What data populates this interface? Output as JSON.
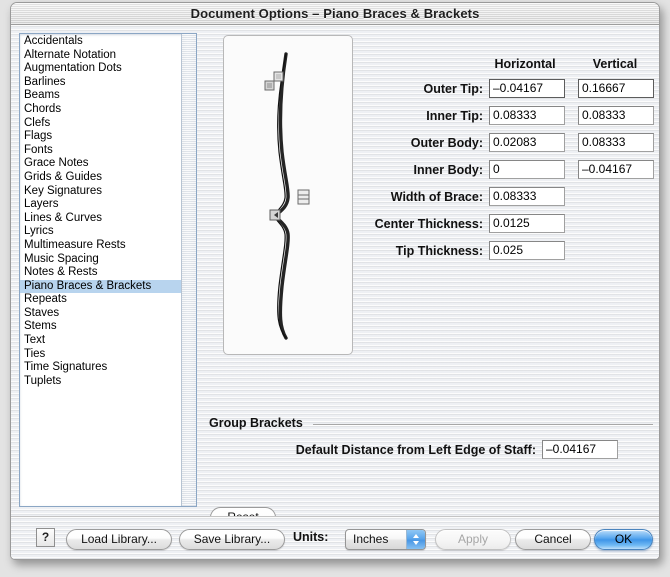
{
  "window": {
    "title": "Document Options – Piano Braces & Brackets"
  },
  "sidebar": {
    "items": [
      {
        "label": "Accidentals",
        "selected": false
      },
      {
        "label": "Alternate Notation",
        "selected": false
      },
      {
        "label": "Augmentation Dots",
        "selected": false
      },
      {
        "label": "Barlines",
        "selected": false
      },
      {
        "label": "Beams",
        "selected": false
      },
      {
        "label": "Chords",
        "selected": false
      },
      {
        "label": "Clefs",
        "selected": false
      },
      {
        "label": "Flags",
        "selected": false
      },
      {
        "label": "Fonts",
        "selected": false
      },
      {
        "label": "Grace Notes",
        "selected": false
      },
      {
        "label": "Grids & Guides",
        "selected": false
      },
      {
        "label": "Key Signatures",
        "selected": false
      },
      {
        "label": "Layers",
        "selected": false
      },
      {
        "label": "Lines & Curves",
        "selected": false
      },
      {
        "label": "Lyrics",
        "selected": false
      },
      {
        "label": "Multimeasure Rests",
        "selected": false
      },
      {
        "label": "Music Spacing",
        "selected": false
      },
      {
        "label": "Notes & Rests",
        "selected": false
      },
      {
        "label": "Piano Braces & Brackets",
        "selected": true
      },
      {
        "label": "Repeats",
        "selected": false
      },
      {
        "label": "Staves",
        "selected": false
      },
      {
        "label": "Stems",
        "selected": false
      },
      {
        "label": "Text",
        "selected": false
      },
      {
        "label": "Ties",
        "selected": false
      },
      {
        "label": "Time Signatures",
        "selected": false
      },
      {
        "label": "Tuplets",
        "selected": false
      }
    ]
  },
  "preview": {
    "name": "piano-brace-preview",
    "handles": [
      "outer-tip-handle",
      "inner-tip-handle",
      "inner-body-handle",
      "thickness-handle"
    ]
  },
  "params": {
    "column_headers": {
      "horizontal": "Horizontal",
      "vertical": "Vertical"
    },
    "rows": [
      {
        "label": "Outer Tip:",
        "horizontal": "–0.04167",
        "vertical": "0.16667",
        "focused": true
      },
      {
        "label": "Inner Tip:",
        "horizontal": "0.08333",
        "vertical": "0.08333",
        "focused": false
      },
      {
        "label": "Outer Body:",
        "horizontal": "0.02083",
        "vertical": "0.08333",
        "focused": false
      },
      {
        "label": "Inner Body:",
        "horizontal": "0",
        "vertical": "–0.04167",
        "focused": false
      },
      {
        "label": "Width of Brace:",
        "horizontal": "0.08333",
        "vertical": null,
        "focused": false
      },
      {
        "label": "Center Thickness:",
        "horizontal": "0.0125",
        "vertical": null,
        "focused": false
      },
      {
        "label": "Tip Thickness:",
        "horizontal": "0.025",
        "vertical": null,
        "focused": false
      }
    ]
  },
  "group_brackets": {
    "title": "Group Brackets",
    "distance_label": "Default Distance from Left Edge of Staff:",
    "distance_value": "–0.04167"
  },
  "reset": {
    "label": "Reset"
  },
  "bottom_bar": {
    "help_label": "?",
    "load_library": "Load Library...",
    "save_library": "Save Library...",
    "units_label": "Units:",
    "units_value": "Inches",
    "apply": "Apply",
    "apply_disabled": true,
    "cancel": "Cancel",
    "ok": "OK"
  },
  "colors": {
    "selection": "#b8d4ee",
    "default_button": "#4a97e4",
    "list_border": "#8ba6c4",
    "window_bg": "#ededed"
  }
}
